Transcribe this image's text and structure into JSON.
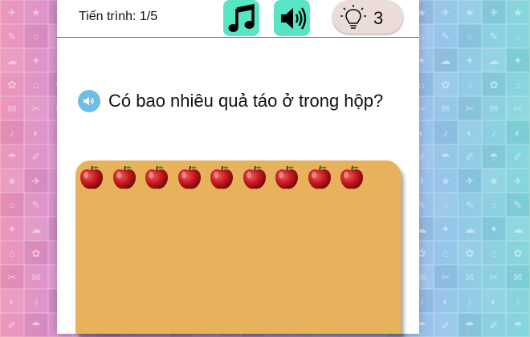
{
  "header": {
    "progress_label": "Tiến trình: 1/5",
    "hint_count": "3"
  },
  "icons": {
    "music": "music-note-icon",
    "sound": "speaker-icon",
    "hint": "lightbulb-icon"
  },
  "question": {
    "text": "Có bao nhiêu quả táo ở trong hộp?"
  },
  "box": {
    "apple_count": 9
  },
  "colors": {
    "icon_button_bg": "#57e5c4",
    "hint_bg": "#ecdcd8",
    "box_bg": "#e8b25c",
    "speaker_circle": "#6dbde6",
    "apple": "#c4161c"
  }
}
